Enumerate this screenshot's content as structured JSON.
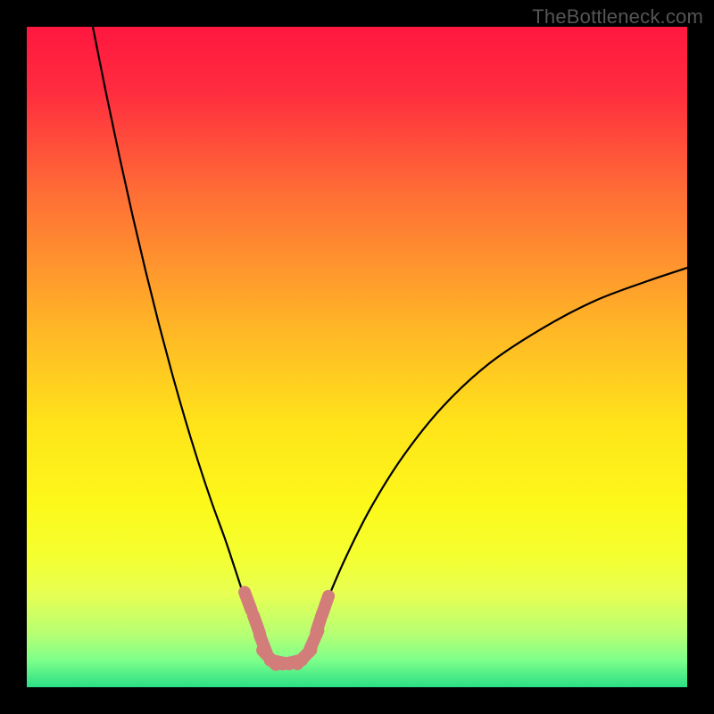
{
  "watermark": "TheBottleneck.com",
  "colors": {
    "frame": "#000000",
    "gradient_stops": [
      {
        "offset": 0.0,
        "color": "#ff173f"
      },
      {
        "offset": 0.1,
        "color": "#ff2d3f"
      },
      {
        "offset": 0.25,
        "color": "#ff6d36"
      },
      {
        "offset": 0.45,
        "color": "#ffb427"
      },
      {
        "offset": 0.6,
        "color": "#ffe31a"
      },
      {
        "offset": 0.72,
        "color": "#fdf81a"
      },
      {
        "offset": 0.8,
        "color": "#f5ff2f"
      },
      {
        "offset": 0.86,
        "color": "#e6ff53"
      },
      {
        "offset": 0.92,
        "color": "#b6ff74"
      },
      {
        "offset": 0.96,
        "color": "#7cff8a"
      },
      {
        "offset": 1.0,
        "color": "#2bdf86"
      }
    ],
    "curve": "#000000",
    "marker_fill": "#d37d7b",
    "marker_stroke": "#ad5a56"
  },
  "chart_data": {
    "type": "line",
    "title": "",
    "xlabel": "",
    "ylabel": "",
    "xlim": [
      0,
      100
    ],
    "ylim": [
      0,
      100
    ],
    "grid": false,
    "legend": false,
    "series": [
      {
        "name": "left-branch",
        "x": [
          10.0,
          12.0,
          14.0,
          16.0,
          18.0,
          20.0,
          22.0,
          24.0,
          26.0,
          28.0,
          30.0,
          31.5,
          33.0,
          34.3,
          35.5,
          36.5
        ],
        "y": [
          100.0,
          90.0,
          80.5,
          71.5,
          63.0,
          55.0,
          47.5,
          40.5,
          34.0,
          28.0,
          22.5,
          18.0,
          13.5,
          10.2,
          7.5,
          5.0
        ]
      },
      {
        "name": "right-branch",
        "x": [
          42.0,
          43.2,
          45.0,
          48.0,
          52.0,
          57.0,
          63.0,
          70.0,
          78.0,
          86.0,
          94.0,
          100.0
        ],
        "y": [
          5.0,
          7.6,
          12.0,
          19.0,
          27.0,
          35.0,
          42.5,
          49.0,
          54.3,
          58.5,
          61.5,
          63.5
        ]
      }
    ],
    "markers": [
      {
        "x": 33.5,
        "y": 13.0
      },
      {
        "x": 34.8,
        "y": 9.5
      },
      {
        "x": 35.8,
        "y": 6.5
      },
      {
        "x": 36.7,
        "y": 4.5
      },
      {
        "x": 38.3,
        "y": 3.8
      },
      {
        "x": 40.2,
        "y": 3.8
      },
      {
        "x": 42.0,
        "y": 4.6
      },
      {
        "x": 43.5,
        "y": 7.2
      },
      {
        "x": 44.3,
        "y": 9.8
      },
      {
        "x": 45.2,
        "y": 12.4
      }
    ],
    "annotations": []
  }
}
